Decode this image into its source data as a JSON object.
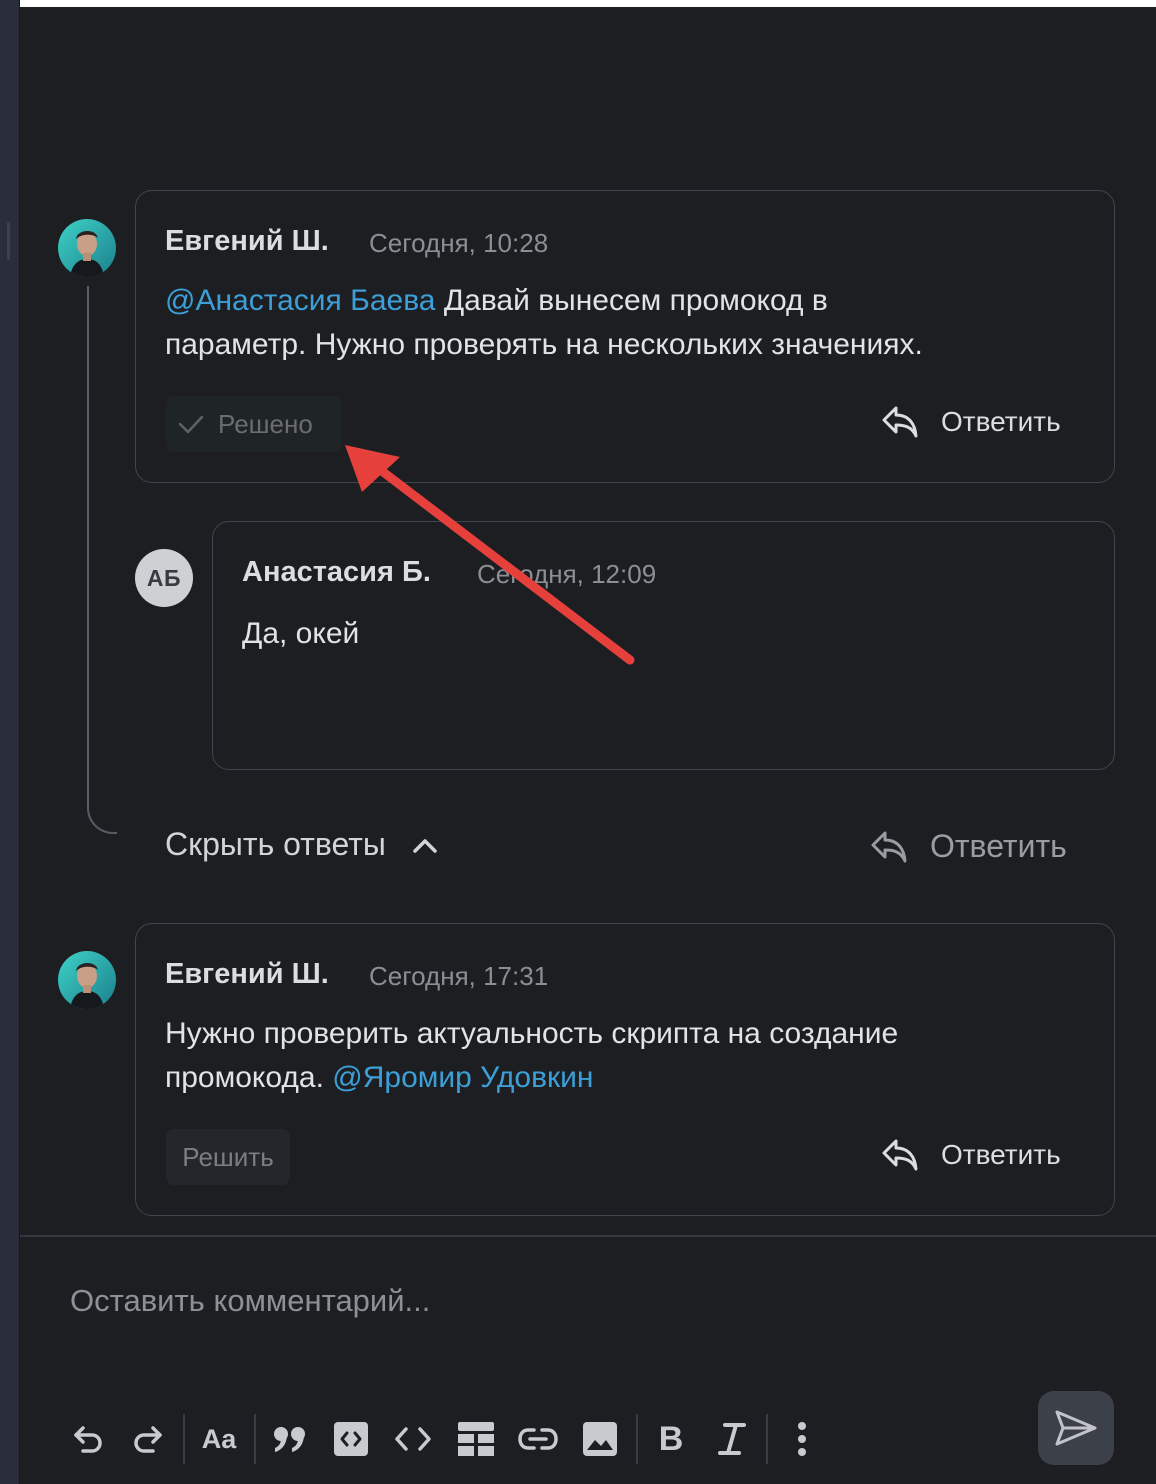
{
  "comments": [
    {
      "author": "Евгений Ш.",
      "time": "Сегодня, 10:28",
      "text_mention": "@Анастасия Баева",
      "text_line1_rest": " Давай вынесем промокод в",
      "text_line2": "параметр. Нужно проверять на нескольких значениях.",
      "status_label": "Решено",
      "reply_label": "Ответить"
    },
    {
      "avatar_initials": "АБ",
      "author": "Анастасия Б.",
      "time": "Сегодня, 12:09",
      "text": "Да, окей"
    },
    {
      "author": "Евгений Ш.",
      "time": "Сегодня, 17:31",
      "text_line1": "Нужно проверить актуальность скрипта на создание",
      "text_line2_start": "промокода. ",
      "text_mention": "@Яромир Удовкин",
      "resolve_label": "Решить",
      "reply_label": "Ответить"
    }
  ],
  "thread": {
    "hide_replies_label": "Скрыть ответы",
    "reply_label": "Ответить"
  },
  "composer": {
    "placeholder": "Оставить комментарий..."
  },
  "toolbar": {
    "items": [
      "undo-icon",
      "redo-icon",
      "text-format-icon",
      "quote-icon",
      "code-block-icon",
      "inline-code-icon",
      "table-icon",
      "link-icon",
      "image-icon",
      "bold-icon",
      "italic-icon",
      "more-icon"
    ],
    "text_format_label": "Aa"
  },
  "colors": {
    "background": "#1d1e22",
    "mention": "#3c9fd8",
    "annotation_arrow": "#e5403b"
  }
}
